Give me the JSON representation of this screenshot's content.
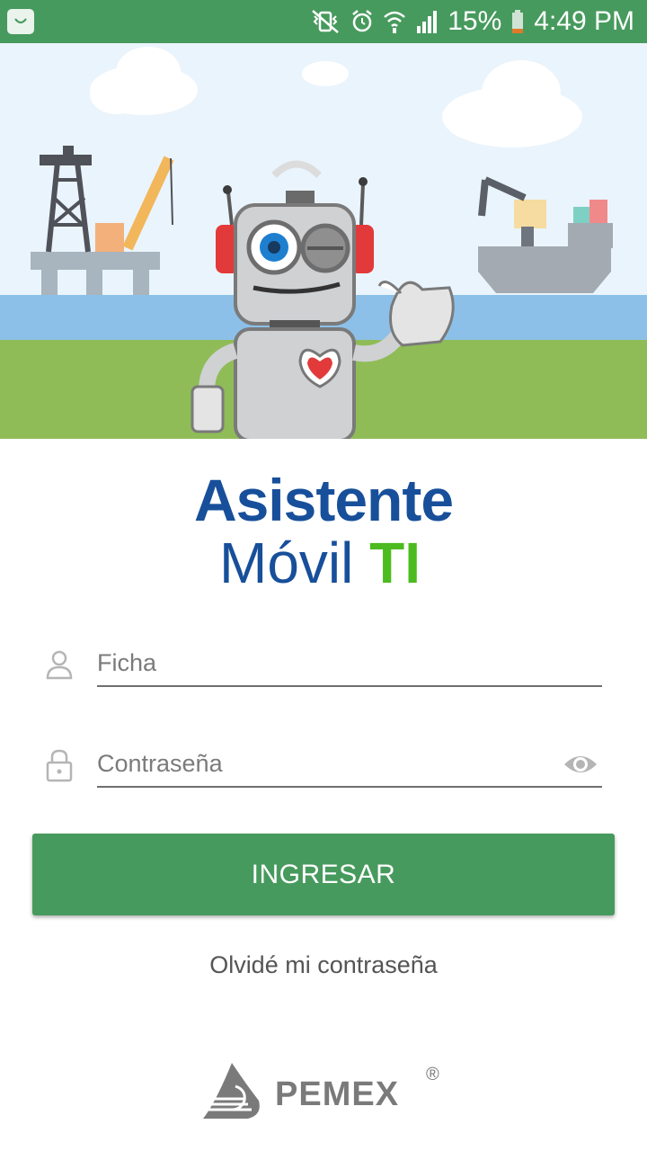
{
  "status_bar": {
    "battery": "15%",
    "time": "4:49 PM"
  },
  "logo": {
    "line1": "Asistente",
    "line2_a": "Móvil",
    "line2_b": "TI"
  },
  "form": {
    "username_placeholder": "Ficha",
    "password_placeholder": "Contraseña",
    "submit_label": "INGRESAR",
    "forgot_label": "Olvidé mi contraseña"
  },
  "footer": {
    "brand": "PEMEX",
    "registered": "®"
  },
  "colors": {
    "primary": "#479a5d",
    "logo_blue": "#174f9a",
    "logo_green": "#4cbb1f"
  }
}
